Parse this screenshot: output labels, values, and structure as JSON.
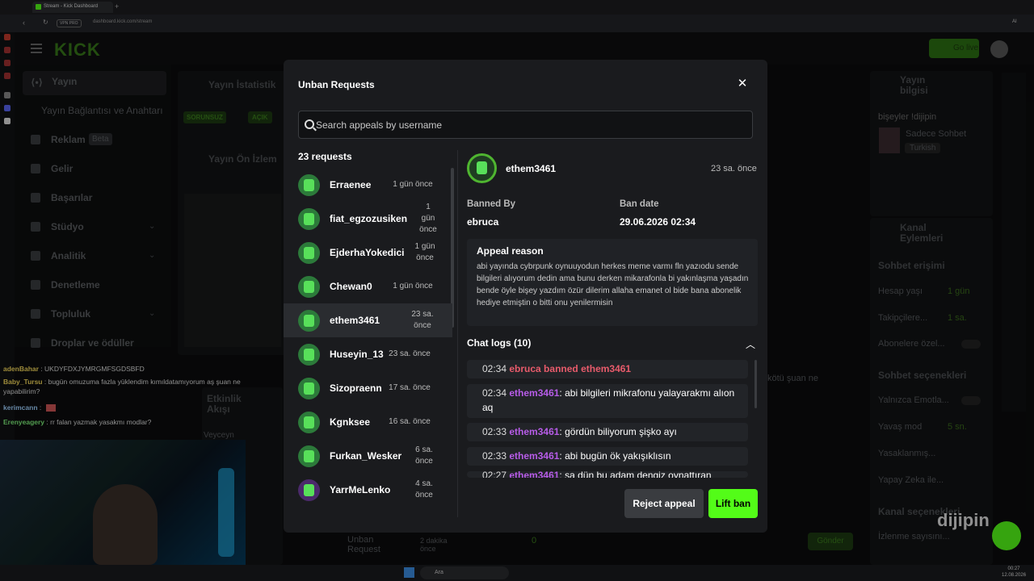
{
  "browser": {
    "tab_title": "Stream - Kick Dashboard",
    "vpn_label": "VPN PRO",
    "url": "dashboard.kick.com/stream",
    "ai_label": "AI"
  },
  "app": {
    "logo": "KICK",
    "go_live": "Go live"
  },
  "sidebar": {
    "items": [
      {
        "label": "Yayın",
        "icon": "broadcast-icon"
      },
      {
        "label": "Yayın Bağlantısı ve Anahtarı"
      },
      {
        "label": "Reklam",
        "badge": "Beta",
        "icon": "ad-icon"
      },
      {
        "label": "Gelir",
        "icon": "revenue-icon"
      },
      {
        "label": "Başarılar",
        "icon": "trophy-icon"
      },
      {
        "label": "Stüdyo",
        "icon": "studio-icon"
      },
      {
        "label": "Analitik",
        "icon": "analytics-icon"
      },
      {
        "label": "Denetleme",
        "icon": "moderation-icon"
      },
      {
        "label": "Topluluk",
        "icon": "community-icon"
      },
      {
        "label": "Droplar ve ödüller",
        "icon": "gift-icon"
      }
    ]
  },
  "background": {
    "stats_title": "Yayın İstatistik",
    "badge1": "SORUNSUZ",
    "badge2": "AÇIK",
    "preview_title": "Yayın Ön İzlem",
    "stream_info": "Yayın bilgisi",
    "stream_title": "bişeyler !dijipin",
    "category": "Sadece Sohbet",
    "language": "Turkish",
    "channel_actions": "Kanal Eylemleri",
    "chat_access": "Sohbet erişimi",
    "account_age": "Hesap yaşı",
    "account_age_val": "1 gün",
    "followers": "Takipçilere...",
    "followers_val": "1 sa.",
    "subs": "Abonelere özel...",
    "chat_options": "Sohbet seçenekleri",
    "emotes": "Yalnızca Emotla...",
    "slow_mode": "Yavaş mod",
    "slow_val": "5 sn.",
    "banned": "Yasaklanmış...",
    "ai_mod": "Yapay Zeka ile...",
    "channel_pick": "Kanal seçenekleri",
    "viewers": "İzlenme sayısını...",
    "send": "Gönder",
    "activity": "Etkinlik Akışı",
    "veyceyn": "Veyceyn",
    "unban_footer": "Unban Request",
    "footer_time": "2 dakika önce",
    "count_zero": "0",
    "stream_text": "kötü şuan ne",
    "watermark": "dijipin"
  },
  "chat_overlay": [
    {
      "name": "adenBahar",
      "color": "#f3d75b",
      "text": "UKDYFDXJYMRGMFSGDSBFD"
    },
    {
      "name": "Baby_Tursu",
      "color": "#f3d75b",
      "text": "bugün omuzuma fazla yüklendim kımıldatamıyorum aş şuan ne yapabilirim?"
    },
    {
      "name": "kerimcann",
      "color": "#9fd1ff",
      "text": ""
    },
    {
      "name": "Erenyeagery",
      "color": "#7ef07a",
      "text": "rr falan yazmak yasakmı modlar?"
    }
  ],
  "modal": {
    "title": "Unban Requests",
    "search_placeholder": "Search appeals by username",
    "request_count": "23 requests",
    "requests": [
      {
        "name": "Erraenee",
        "time": "1 gün önce"
      },
      {
        "name": "fiat_egzozusiken",
        "time": "1 gün önce"
      },
      {
        "name": "EjderhaYokedici",
        "time": "1 gün önce"
      },
      {
        "name": "Chewan0",
        "time": "1 gün önce"
      },
      {
        "name": "ethem3461",
        "time": "23 sa. önce",
        "selected": true
      },
      {
        "name": "Huseyin_13",
        "time": "23 sa. önce"
      },
      {
        "name": "Sizopraenn",
        "time": "17 sa. önce"
      },
      {
        "name": "Kgnksee",
        "time": "16 sa. önce"
      },
      {
        "name": "Furkan_Wesker",
        "time": "6 sa. önce"
      },
      {
        "name": "YarrMeLenko",
        "time": "4 sa. önce"
      }
    ],
    "detail": {
      "username": "ethem3461",
      "time": "23 sa. önce",
      "banned_by_label": "Banned By",
      "banned_by": "ebruca",
      "ban_date_label": "Ban date",
      "ban_date": "29.06.2026 02:34",
      "appeal_label": "Appeal reason",
      "appeal_text": "abi yayında cybrpunk oynuuyodun herkes meme varmı fln yazıodu sende bilgileri alıyorum dedin ama bunu derken mikarafonla bi yakınlaşma yaşadın bende öyle bişey yazdım özür dilerim allaha emanet ol bide bana abonelik hediye etmiştin o bitti onu yenilermisin",
      "chat_logs_label": "Chat logs (10)",
      "logs": [
        {
          "time": "02:34",
          "ban": "ebruca banned ethem3461"
        },
        {
          "time": "02:34",
          "user": "ethem3461",
          "text": ": abi bilgileri mikrafonu yalayarakmı alıon aq"
        },
        {
          "time": "02:33",
          "user": "ethem3461",
          "text": ": gördün biliyorum şişko ayı"
        },
        {
          "time": "02:33",
          "user": "ethem3461",
          "text": ": abi bugün ök yakışıklısın"
        },
        {
          "time": "02:27",
          "user": "ethem3461",
          "text": ": sa dün bu adam dengiz oynattıran"
        }
      ]
    },
    "reject_label": "Reject appeal",
    "lift_label": "Lift ban"
  },
  "taskbar": {
    "search_label": "Ara",
    "time": "00:27",
    "date": "12.08.2026"
  },
  "colors": {
    "accent": "#53fc18",
    "modal_bg": "#1a1b1e",
    "ban_text": "#e85b6b",
    "user_text": "#b75ce8"
  }
}
